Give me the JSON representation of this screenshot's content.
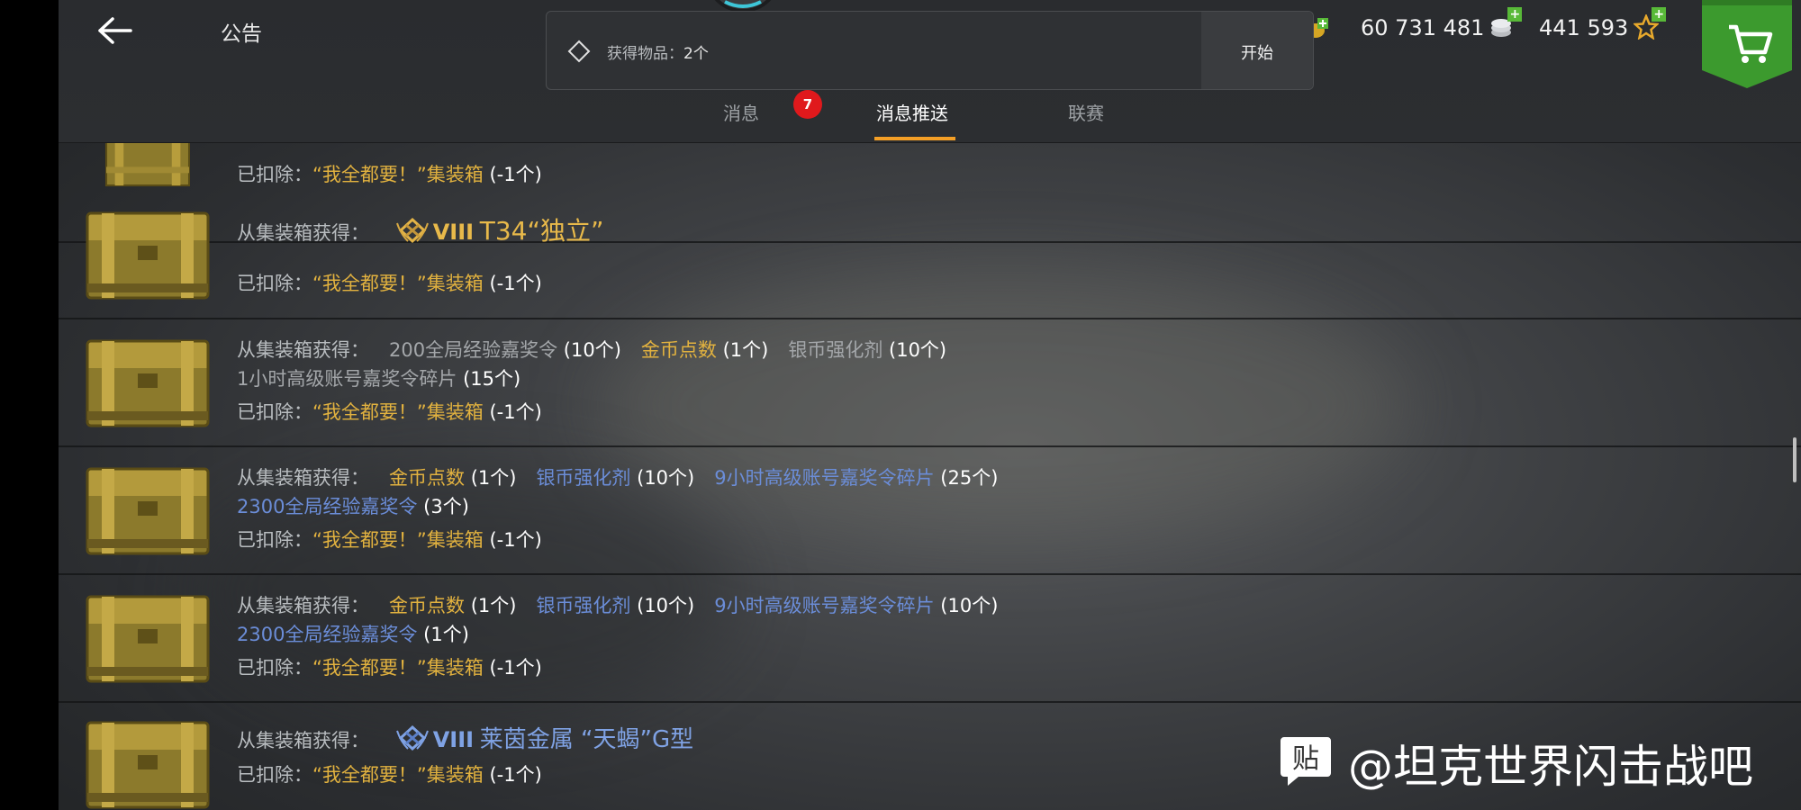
{
  "header": {
    "title": "公告",
    "silver": "60 731 481",
    "free_xp": "441 593"
  },
  "popup": {
    "label": "获得物品：",
    "count": "2个",
    "start": "开始"
  },
  "tabs": [
    {
      "label": "消息",
      "badge": "7"
    },
    {
      "label": "消息推送"
    },
    {
      "label": "联赛"
    }
  ],
  "labels": {
    "from_crate": "从集装箱获得：",
    "deducted": "已扣除："
  },
  "rows": [
    {
      "deducted_item": "“我全都要！”集装箱",
      "deducted_qty": "(-1个)"
    },
    {
      "tank_tier": "VIII",
      "tank_name": "T34“独立”",
      "deducted_item": "“我全都要！”集装箱",
      "deducted_qty": "(-1个)"
    },
    {
      "r1_a": "200全局经验嘉奖令",
      "r1_a_q": "(10个)",
      "r1_b": "金币点数",
      "r1_b_q": "(1个)",
      "r1_c": "银币强化剂",
      "r1_c_q": "(10个)",
      "r2_a": "1小时高级账号嘉奖令碎片",
      "r2_a_q": "(15个)",
      "deducted_item": "“我全都要！”集装箱",
      "deducted_qty": "(-1个)"
    },
    {
      "r1_a": "金币点数",
      "r1_a_q": "(1个)",
      "r1_b": "银币强化剂",
      "r1_b_q": "(10个)",
      "r1_c": "9小时高级账号嘉奖令碎片",
      "r1_c_q": "(25个)",
      "r2_a": "2300全局经验嘉奖令",
      "r2_a_q": "(3个)",
      "deducted_item": "“我全都要！”集装箱",
      "deducted_qty": "(-1个)"
    },
    {
      "r1_a": "金币点数",
      "r1_a_q": "(1个)",
      "r1_b": "银币强化剂",
      "r1_b_q": "(10个)",
      "r1_c": "9小时高级账号嘉奖令碎片",
      "r1_c_q": "(10个)",
      "r2_a": "2300全局经验嘉奖令",
      "r2_a_q": "(1个)",
      "deducted_item": "“我全都要！”集装箱",
      "deducted_qty": "(-1个)"
    },
    {
      "tank_tier": "VIII",
      "tank_name": "莱茵金属 “天蝎”G型",
      "deducted_item": "“我全都要！”集装箱",
      "deducted_qty": "(-1个)"
    }
  ],
  "watermark": {
    "text": "@坦克世界闪击战吧"
  },
  "colors": {
    "accent_orange": "#f49f26",
    "gold_text": "#e2b23f",
    "blue_text": "#6b8dd8",
    "shop_green": "#3c9a2e",
    "badge_red": "#e0191c"
  }
}
